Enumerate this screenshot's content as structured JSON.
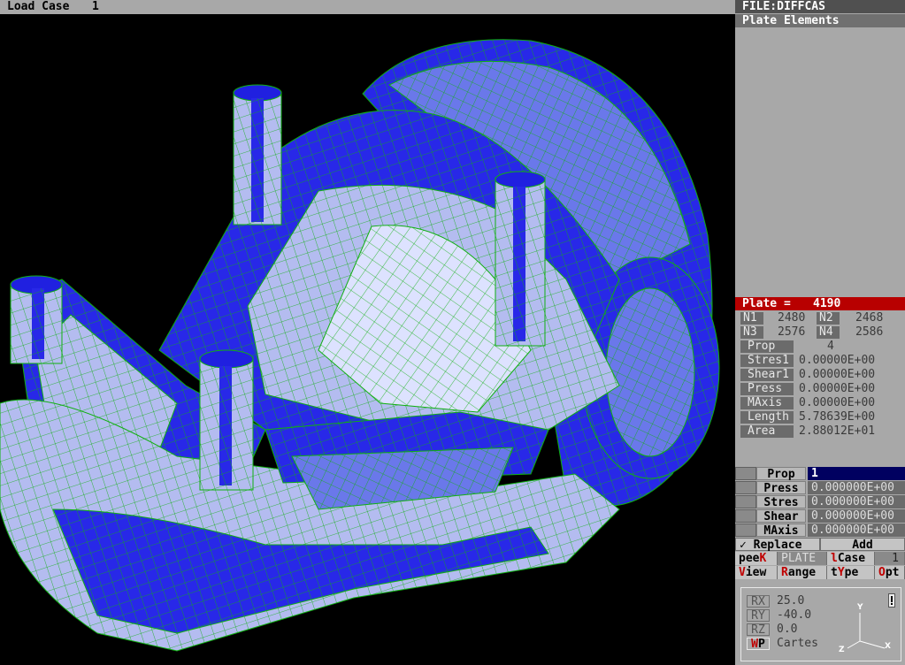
{
  "topbar": {
    "load_case_label": "Load Case",
    "load_case_value": "1"
  },
  "panel": {
    "file_title": "FILE:DIFFCAS",
    "section_title": "Plate Elements",
    "plate_label": "Plate =",
    "plate_value": "4190",
    "nodes": {
      "n1_label": "N1",
      "n1": "2480",
      "n2_label": "N2",
      "n2": "2468",
      "n3_label": "N3",
      "n3": "2576",
      "n4_label": "N4",
      "n4": "2586"
    },
    "props": [
      {
        "label": "Prop",
        "value": "4"
      },
      {
        "label": "Stres1",
        "value": "0.00000E+00"
      },
      {
        "label": "Shear1",
        "value": "0.00000E+00"
      },
      {
        "label": "Press",
        "value": "0.00000E+00"
      },
      {
        "label": "MAxis",
        "value": "0.00000E+00"
      },
      {
        "label": "Length",
        "value": "5.78639E+00"
      },
      {
        "label": "Area",
        "value": "2.88012E+01"
      }
    ],
    "edit_rows": [
      {
        "label": "Prop",
        "value": "1"
      },
      {
        "label": "Press",
        "value": "0.000000E+00"
      },
      {
        "label": "Stres",
        "value": "0.000000E+00"
      },
      {
        "label": "Shear",
        "value": "0.000000E+00"
      },
      {
        "label": "MAxis",
        "value": "0.000000E+00"
      }
    ],
    "replace_label": "✓ Replace",
    "add_label": "Add",
    "buttons": {
      "peek_a": "pee",
      "peek_b": "K",
      "plate": "PLATE",
      "lcase_a": "l",
      "lcase_b": "Case",
      "lcase_value": "1",
      "view_a": "V",
      "view_b": "iew",
      "range_a": "R",
      "range_b": "ange",
      "type_a": "t",
      "type_b": "Y",
      "type_c": "pe",
      "opt_a": "O",
      "opt_b": "pt"
    },
    "rotation": {
      "rx_label": "RX",
      "rx": "25.0",
      "ry_label": "RY",
      "ry": "-40.0",
      "rz_label": "RZ",
      "rz": "0.0",
      "wp_a": "W",
      "wp_b": "P",
      "coord": "Cartes",
      "axis_x": "X",
      "axis_y": "Y",
      "axis_z": "Z"
    }
  },
  "colors": {
    "mesh_dark": "#2020e8",
    "mesh_light": "#b8c0f0",
    "edge": "#00cc00",
    "accent": "#b80000"
  }
}
